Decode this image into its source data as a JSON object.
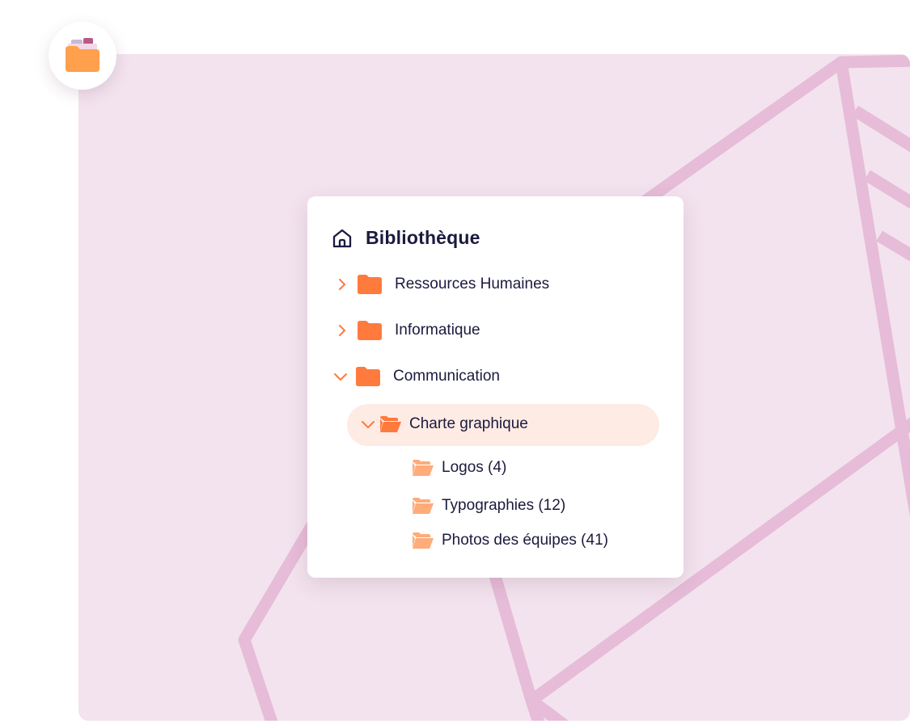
{
  "colors": {
    "background": "#f3e3ee",
    "decoration": "#e6bcd8",
    "accent": "#ff7a3d",
    "accent_light": "#ffab7a",
    "selected_row": "#fdebe4",
    "text": "#1b1a3e"
  },
  "app_icon": "folder-icon",
  "library": {
    "title": "Bibliothèque",
    "title_icon": "home-icon",
    "folders": [
      {
        "label": "Ressources Humaines",
        "state": "collapsed"
      },
      {
        "label": "Informatique",
        "state": "collapsed"
      },
      {
        "label": "Communication",
        "state": "expanded"
      }
    ],
    "selected_folder": {
      "label": "Charte graphique",
      "state": "expanded"
    },
    "subfolders": [
      {
        "label": "Logos (4)"
      },
      {
        "label": "Typographies (12)"
      },
      {
        "label": "Photos des équipes (41)"
      }
    ]
  }
}
